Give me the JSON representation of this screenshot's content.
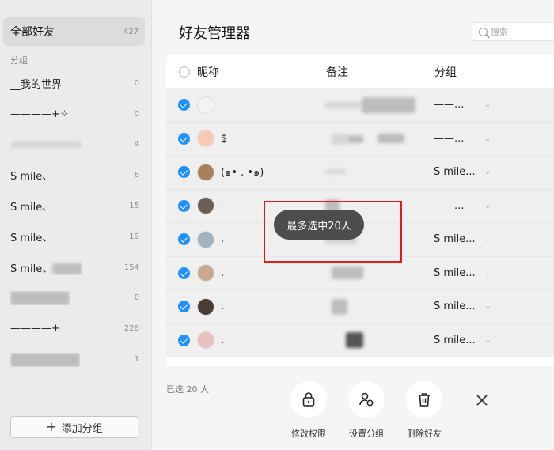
{
  "sidebar": {
    "all_friends": {
      "label": "全部好友",
      "count": "427"
    },
    "group_header": "分组",
    "groups": [
      {
        "name": "__我的世界",
        "count": "0"
      },
      {
        "name": "————+✧",
        "count": "0"
      },
      {
        "name": "",
        "count": "4"
      },
      {
        "name": "S mile、",
        "count": "6"
      },
      {
        "name": "S mile、",
        "count": "15"
      },
      {
        "name": "S mile、",
        "count": "19"
      },
      {
        "name": "S mile、",
        "count": "154"
      },
      {
        "name": "",
        "count": "0"
      },
      {
        "name": "————+",
        "count": "228"
      },
      {
        "name": "",
        "count": "1"
      }
    ],
    "add_group_label": "添加分组"
  },
  "main": {
    "title": "好友管理器",
    "search_placeholder": "搜索",
    "columns": {
      "nickname": "昵称",
      "note": "备注",
      "group": "分组"
    },
    "rows": [
      {
        "nickname": "",
        "group": "——...",
        "avatar_color": "#f3f3f3"
      },
      {
        "nickname": "$",
        "group": "——...",
        "avatar_color": "#f6c9b8"
      },
      {
        "nickname": "(๑• . •๑)",
        "group": "S mile...",
        "avatar_color": "#a8815a"
      },
      {
        "nickname": "-",
        "group": "——...",
        "avatar_color": "#6b5e55"
      },
      {
        "nickname": ".",
        "group": "S mile...",
        "avatar_color": "#9fb3c4"
      },
      {
        "nickname": ".",
        "group": "S mile...",
        "avatar_color": "#c9a98e"
      },
      {
        "nickname": ".",
        "group": "S mile...",
        "avatar_color": "#4a3b35"
      },
      {
        "nickname": ".",
        "group": "S mile...",
        "avatar_color": "#e7c0c0"
      }
    ]
  },
  "footer": {
    "selected_text": "已选 20 人",
    "actions": [
      {
        "label": "修改权限",
        "icon": "lock-icon"
      },
      {
        "label": "设置分组",
        "icon": "user-settings-icon"
      },
      {
        "label": "删除好友",
        "icon": "trash-icon"
      }
    ]
  },
  "toast": {
    "text": "最多选中20人"
  },
  "colors": {
    "accent": "#1e90ff",
    "highlight": "#e21b1b",
    "toast_bg": "#4d4d4d"
  }
}
